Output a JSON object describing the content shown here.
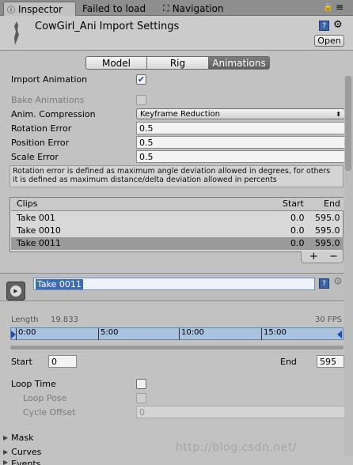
{
  "tabs": {
    "inspector": "Inspector",
    "failed": "Failed to load",
    "navigation": "Navigation"
  },
  "header": {
    "title": "CowGirl_Ani Import Settings",
    "open_label": "Open"
  },
  "segments": [
    "Model",
    "Rig",
    "Animations"
  ],
  "form": {
    "import_animation": "Import Animation",
    "bake_animations": "Bake Animations",
    "anim_compression": "Anim. Compression",
    "anim_compression_value": "Keyframe Reduction",
    "rotation_error": "Rotation Error",
    "rotation_error_value": "0.5",
    "position_error": "Position Error",
    "position_error_value": "0.5",
    "scale_error": "Scale Error",
    "scale_error_value": "0.5",
    "help_line1": "Rotation error is defined as maximum angle deviation allowed in degrees, for others",
    "help_line2": "it is defined as maximum distance/delta deviation allowed in percents"
  },
  "clips": {
    "header_clips": "Clips",
    "header_start": "Start",
    "header_end": "End",
    "rows": [
      {
        "name": "Take 001",
        "start": "0.0",
        "end": "595.0"
      },
      {
        "name": "Take 0010",
        "start": "0.0",
        "end": "595.0"
      },
      {
        "name": "Take 0011",
        "start": "0.0",
        "end": "595.0"
      }
    ],
    "add": "+",
    "remove": "−"
  },
  "clip_detail": {
    "name": "Take 0011",
    "length_label": "Length",
    "length_value": "19.833",
    "fps": "30 FPS",
    "ticks": [
      "0:00",
      "5:00",
      "10:00",
      "15:00"
    ],
    "start_label": "Start",
    "start_value": "0",
    "end_label": "End",
    "end_value": "595",
    "loop_time": "Loop Time",
    "loop_pose": "Loop Pose",
    "cycle_offset": "Cycle Offset",
    "cycle_offset_value": "0"
  },
  "foldouts": {
    "mask": "Mask",
    "curves": "Curves",
    "events": "Events"
  },
  "watermark": "http://blog.csdn.net/"
}
